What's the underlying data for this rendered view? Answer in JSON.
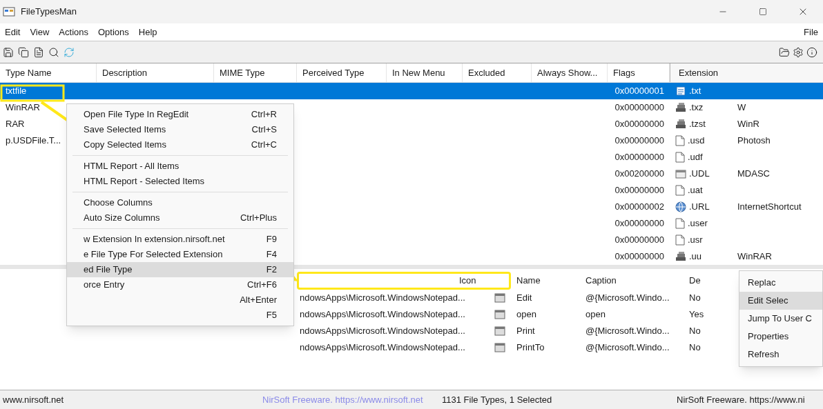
{
  "window": {
    "title": "FileTypesMan"
  },
  "menu_bar": [
    "Edit",
    "View",
    "Actions",
    "Options",
    "Help"
  ],
  "second_window_menu": "File",
  "main_list": {
    "columns": [
      "Type Name",
      "Description",
      "MIME Type",
      "Perceived Type",
      "In New Menu",
      "Excluded",
      "Always Show...",
      "Flags"
    ],
    "extension_column": "Extension",
    "rows": [
      {
        "type_name": "txtfile",
        "flags": "0x00000001",
        "extension": ".txt",
        "kind": "document",
        "selected": true
      },
      {
        "type_name": "WinRAR",
        "flags": "0x00000000",
        "extension": ".txz",
        "kind": "archive",
        "column_2": "W",
        "selected": false
      },
      {
        "type_name": "RAR",
        "flags": "0x00000000",
        "extension": ".tzst",
        "kind": "archive",
        "column_2": "WinR",
        "selected": false
      },
      {
        "type_name": "p.USDFile.T...",
        "flags": "0x00000000",
        "extension": ".usd",
        "kind": "blank",
        "column_2": "Photosh",
        "selected": false
      },
      {
        "flags": "0x00000000",
        "extension": ".udf",
        "kind": "blank",
        "selected": false
      },
      {
        "flags": "0x00200000",
        "extension": ".UDL",
        "kind": "window",
        "column_2": "MDASC",
        "selected": false
      },
      {
        "flags": "0x00000000",
        "extension": ".uat",
        "kind": "blank",
        "selected": false
      },
      {
        "flags": "0x00000002",
        "extension": ".URL",
        "kind": "globe",
        "column_2": "InternetShortcut",
        "selected": false
      },
      {
        "flags": "0x00000000",
        "extension": ".user",
        "kind": "blank",
        "selected": false
      },
      {
        "flags": "0x00000000",
        "extension": ".usr",
        "kind": "blank",
        "selected": false
      },
      {
        "flags": "0x00000000",
        "extension": ".uu",
        "kind": "archive",
        "column_2": "WinRAR",
        "selected": false
      }
    ]
  },
  "context_menu": [
    {
      "kind": "item",
      "label": "Open File Type In RegEdit",
      "shortcut": "Ctrl+R",
      "selected": false
    },
    {
      "kind": "item",
      "label": "Save Selected Items",
      "shortcut": "Ctrl+S",
      "selected": false
    },
    {
      "kind": "item",
      "label": "Copy Selected Items",
      "shortcut": "Ctrl+C",
      "selected": false
    },
    {
      "kind": "separator"
    },
    {
      "kind": "item",
      "label": "HTML Report - All Items",
      "selected": false
    },
    {
      "kind": "item",
      "label": "HTML Report - Selected Items",
      "selected": false
    },
    {
      "kind": "separator"
    },
    {
      "kind": "item",
      "label": "Choose Columns",
      "selected": false
    },
    {
      "kind": "item",
      "label": "Auto Size Columns",
      "shortcut": "Ctrl+Plus",
      "selected": false
    },
    {
      "kind": "separator"
    },
    {
      "kind": "item",
      "label": "w Extension In extension.nirsoft.net",
      "shortcut": "F9",
      "selected": false
    },
    {
      "kind": "item",
      "label": "e File Type For Selected Extension",
      "shortcut": "F4",
      "selected": false
    },
    {
      "kind": "item",
      "label": "ed File Type",
      "shortcut": "F2",
      "selected": true
    },
    {
      "kind": "item",
      "label": "orce Entry",
      "shortcut": "Ctrl+F6",
      "selected": false
    },
    {
      "kind": "item",
      "shortcut": "Alt+Enter",
      "selected": false
    },
    {
      "kind": "item",
      "shortcut": "F5",
      "selected": false
    }
  ],
  "actions_list": {
    "columns": [
      "Icon",
      "Name",
      "Caption",
      "De"
    ],
    "rows": [
      {
        "command": "ndowsApps\\Microsoft.WindowsNotepad...",
        "name": "Edit",
        "caption": "@{Microsoft.Windo...",
        "column_4": "No"
      },
      {
        "command": "ndowsApps\\Microsoft.WindowsNotepad...",
        "name": "open",
        "caption": "open",
        "column_4": "Yes"
      },
      {
        "command": "ndowsApps\\Microsoft.WindowsNotepad...",
        "name": "Print",
        "caption": "@{Microsoft.Windo...",
        "column_4": "No"
      },
      {
        "command": "ndowsApps\\Microsoft.WindowsNotepad...",
        "name": "PrintTo",
        "caption": "@{Microsoft.Windo...",
        "column_4": "No"
      }
    ]
  },
  "side_menu": [
    {
      "label": "Replac",
      "selected": false
    },
    {
      "label": "Edit Selec",
      "selected": true
    },
    {
      "label": "Jump To User C",
      "selected": false
    },
    {
      "label": "Properties",
      "selected": false
    },
    {
      "label": "Refresh",
      "selected": false
    }
  ],
  "status_bar": [
    "www.nirsoft.net",
    "NirSoft Freeware. https://www.nirsoft.net",
    "1131 File Types, 1 Selected",
    "NirSoft Freeware. https://www.ni"
  ]
}
